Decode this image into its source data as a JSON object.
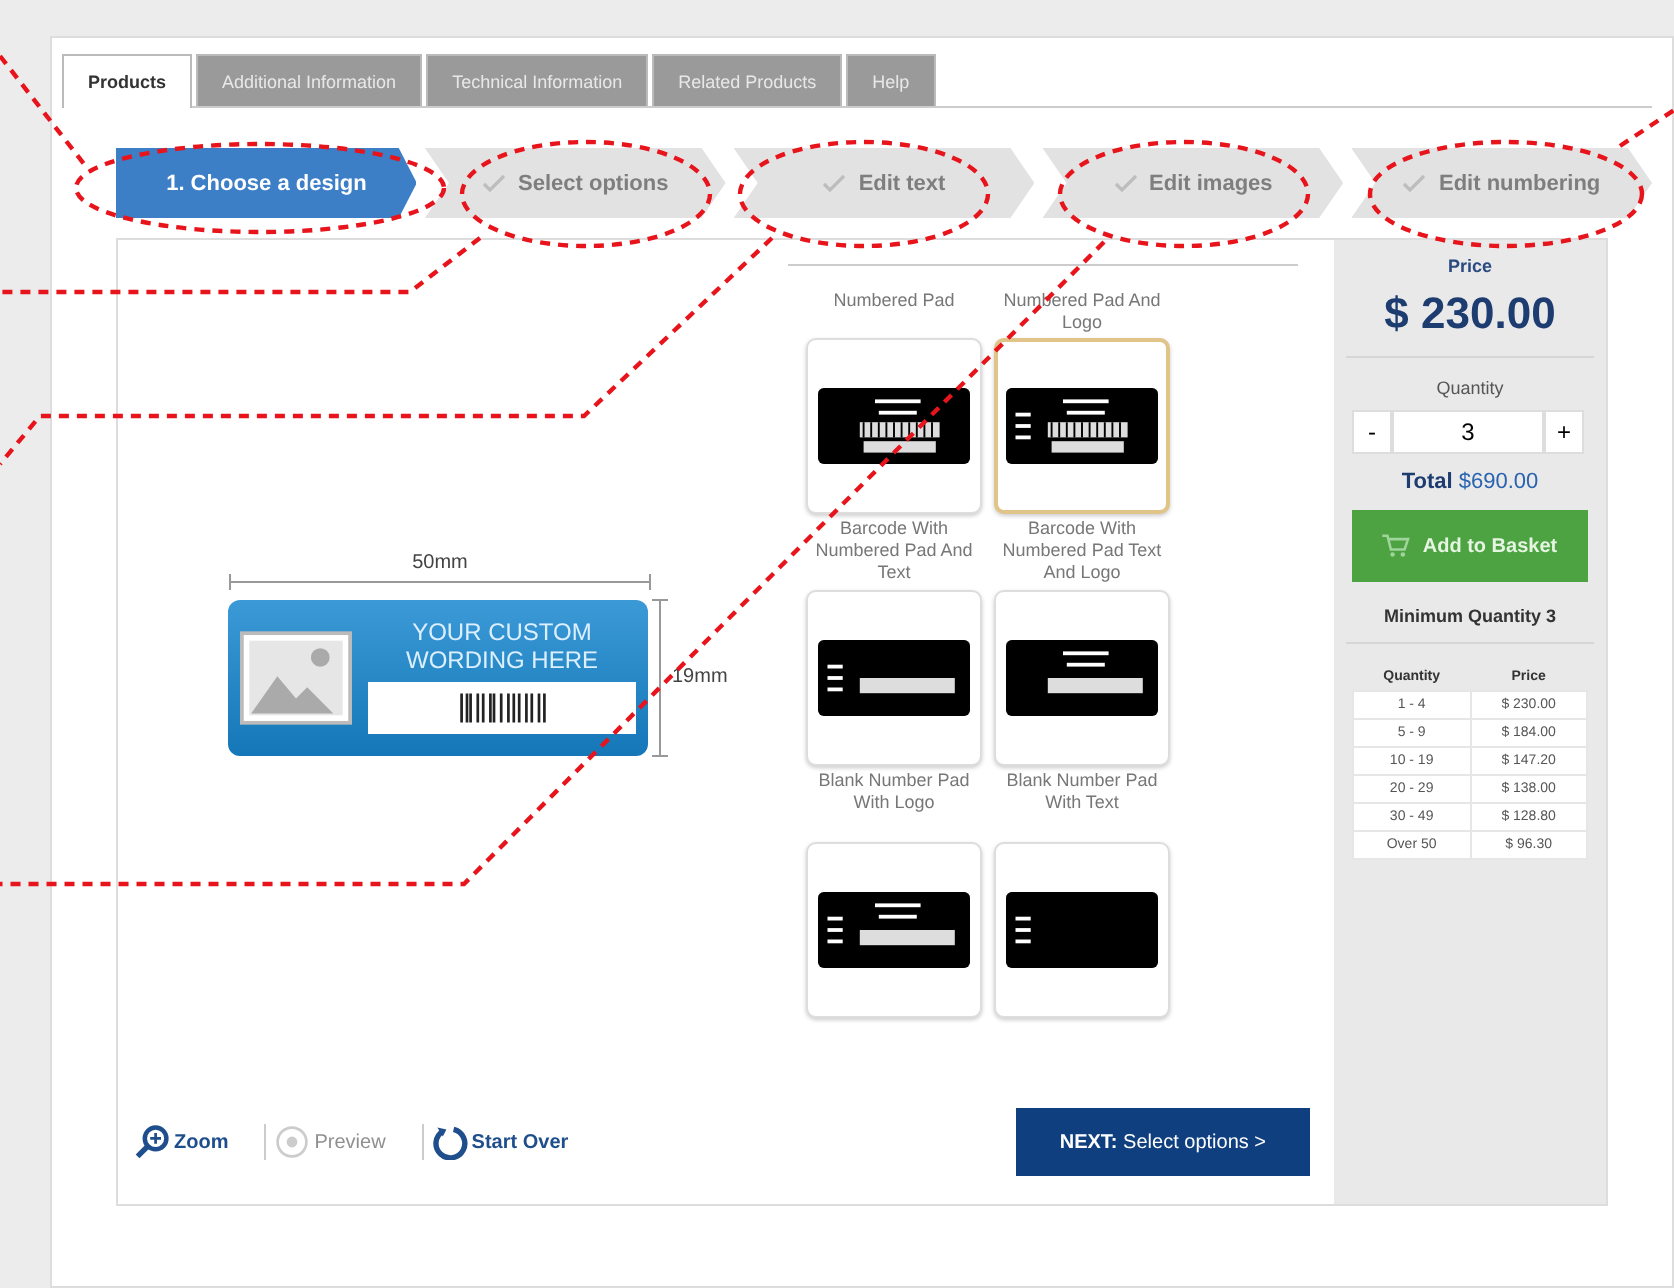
{
  "tabs": [
    {
      "label": "Products",
      "selected": true
    },
    {
      "label": "Additional Information",
      "selected": false
    },
    {
      "label": "Technical Information",
      "selected": false
    },
    {
      "label": "Related Products",
      "selected": false
    },
    {
      "label": "Help",
      "selected": false
    }
  ],
  "steps": [
    {
      "label": "1. Choose a design",
      "selected": true
    },
    {
      "label": "Select options",
      "selected": false
    },
    {
      "label": "Edit text",
      "selected": false
    },
    {
      "label": "Edit images",
      "selected": false
    },
    {
      "label": "Edit numbering",
      "selected": false
    }
  ],
  "preview": {
    "width_label": "50mm",
    "height_label": "19mm",
    "wording": "YOUR CUSTOM WORDING HERE"
  },
  "designs": [
    {
      "name": "Numbered Pad",
      "kind": "pad-barcode",
      "selected": false
    },
    {
      "name": "Numbered Pad And Logo",
      "kind": "logo-barcode",
      "selected": true
    },
    {
      "name": "Barcode With Numbered Pad And Text",
      "kind": "text-field",
      "selected": false
    },
    {
      "name": "Barcode With Numbered Pad Text And Logo",
      "kind": "wording-field",
      "selected": false
    },
    {
      "name": "Blank Number Pad With Logo",
      "kind": "text-wording-field",
      "selected": false
    },
    {
      "name": "Blank Number Pad With Text",
      "kind": "text-only",
      "selected": false
    }
  ],
  "tools": [
    {
      "label": "Zoom",
      "kind": "zoom",
      "disabled": false
    },
    {
      "label": "Preview",
      "kind": "preview",
      "disabled": true
    },
    {
      "label": "Start Over",
      "kind": "restart",
      "disabled": false
    }
  ],
  "next_button": {
    "prefix": "NEXT:",
    "label": "Select options >"
  },
  "price": {
    "heading": "Price",
    "amount": "$ 230.00",
    "quantity_label": "Quantity",
    "minus": "-",
    "quantity": "3",
    "plus": "+",
    "total_label": "Total",
    "total": "$690.00",
    "add_button": "Add to Basket",
    "minimum": "Minimum Quantity 3"
  },
  "price_table": {
    "columns": [
      "Quantity",
      "Price"
    ],
    "rows": [
      [
        "1 - 4",
        "$ 230.00"
      ],
      [
        "5 - 9",
        "$ 184.00"
      ],
      [
        "10 - 19",
        "$ 147.20"
      ],
      [
        "20 - 29",
        "$ 138.00"
      ],
      [
        "30 - 49",
        "$ 128.80"
      ],
      [
        "Over 50",
        "$ 96.30"
      ]
    ]
  }
}
